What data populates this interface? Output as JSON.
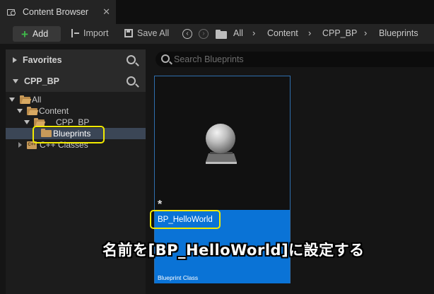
{
  "tab": {
    "title": "Content Browser",
    "close": "✕"
  },
  "toolbar": {
    "add_label": "Add",
    "import_label": "Import",
    "save_all_label": "Save All",
    "breadcrumbs": [
      "All",
      "Content",
      "CPP_BP",
      "Blueprints"
    ]
  },
  "left_panel": {
    "favorites_header": "Favorites",
    "project_header": "CPP_BP",
    "tree": [
      {
        "label": "All"
      },
      {
        "label": "Content"
      },
      {
        "label": "CPP_BP"
      },
      {
        "label": "Blueprints",
        "selected": true
      },
      {
        "label": "C++ Classes",
        "icon_text": "C++"
      }
    ]
  },
  "search": {
    "placeholder": "Search Blueprints"
  },
  "asset": {
    "name": "BP_HelloWorld",
    "type": "Blueprint Class",
    "dirty_marker": "*"
  },
  "annotation": {
    "text": "名前を[BP_HelloWorld]に設定する"
  },
  "colors": {
    "highlight": "#f2ea00",
    "asset_bar": "#0a73d6",
    "add_plus": "#3fb84a",
    "folder": "#c79a5a",
    "selected_row": "#3b4656"
  }
}
